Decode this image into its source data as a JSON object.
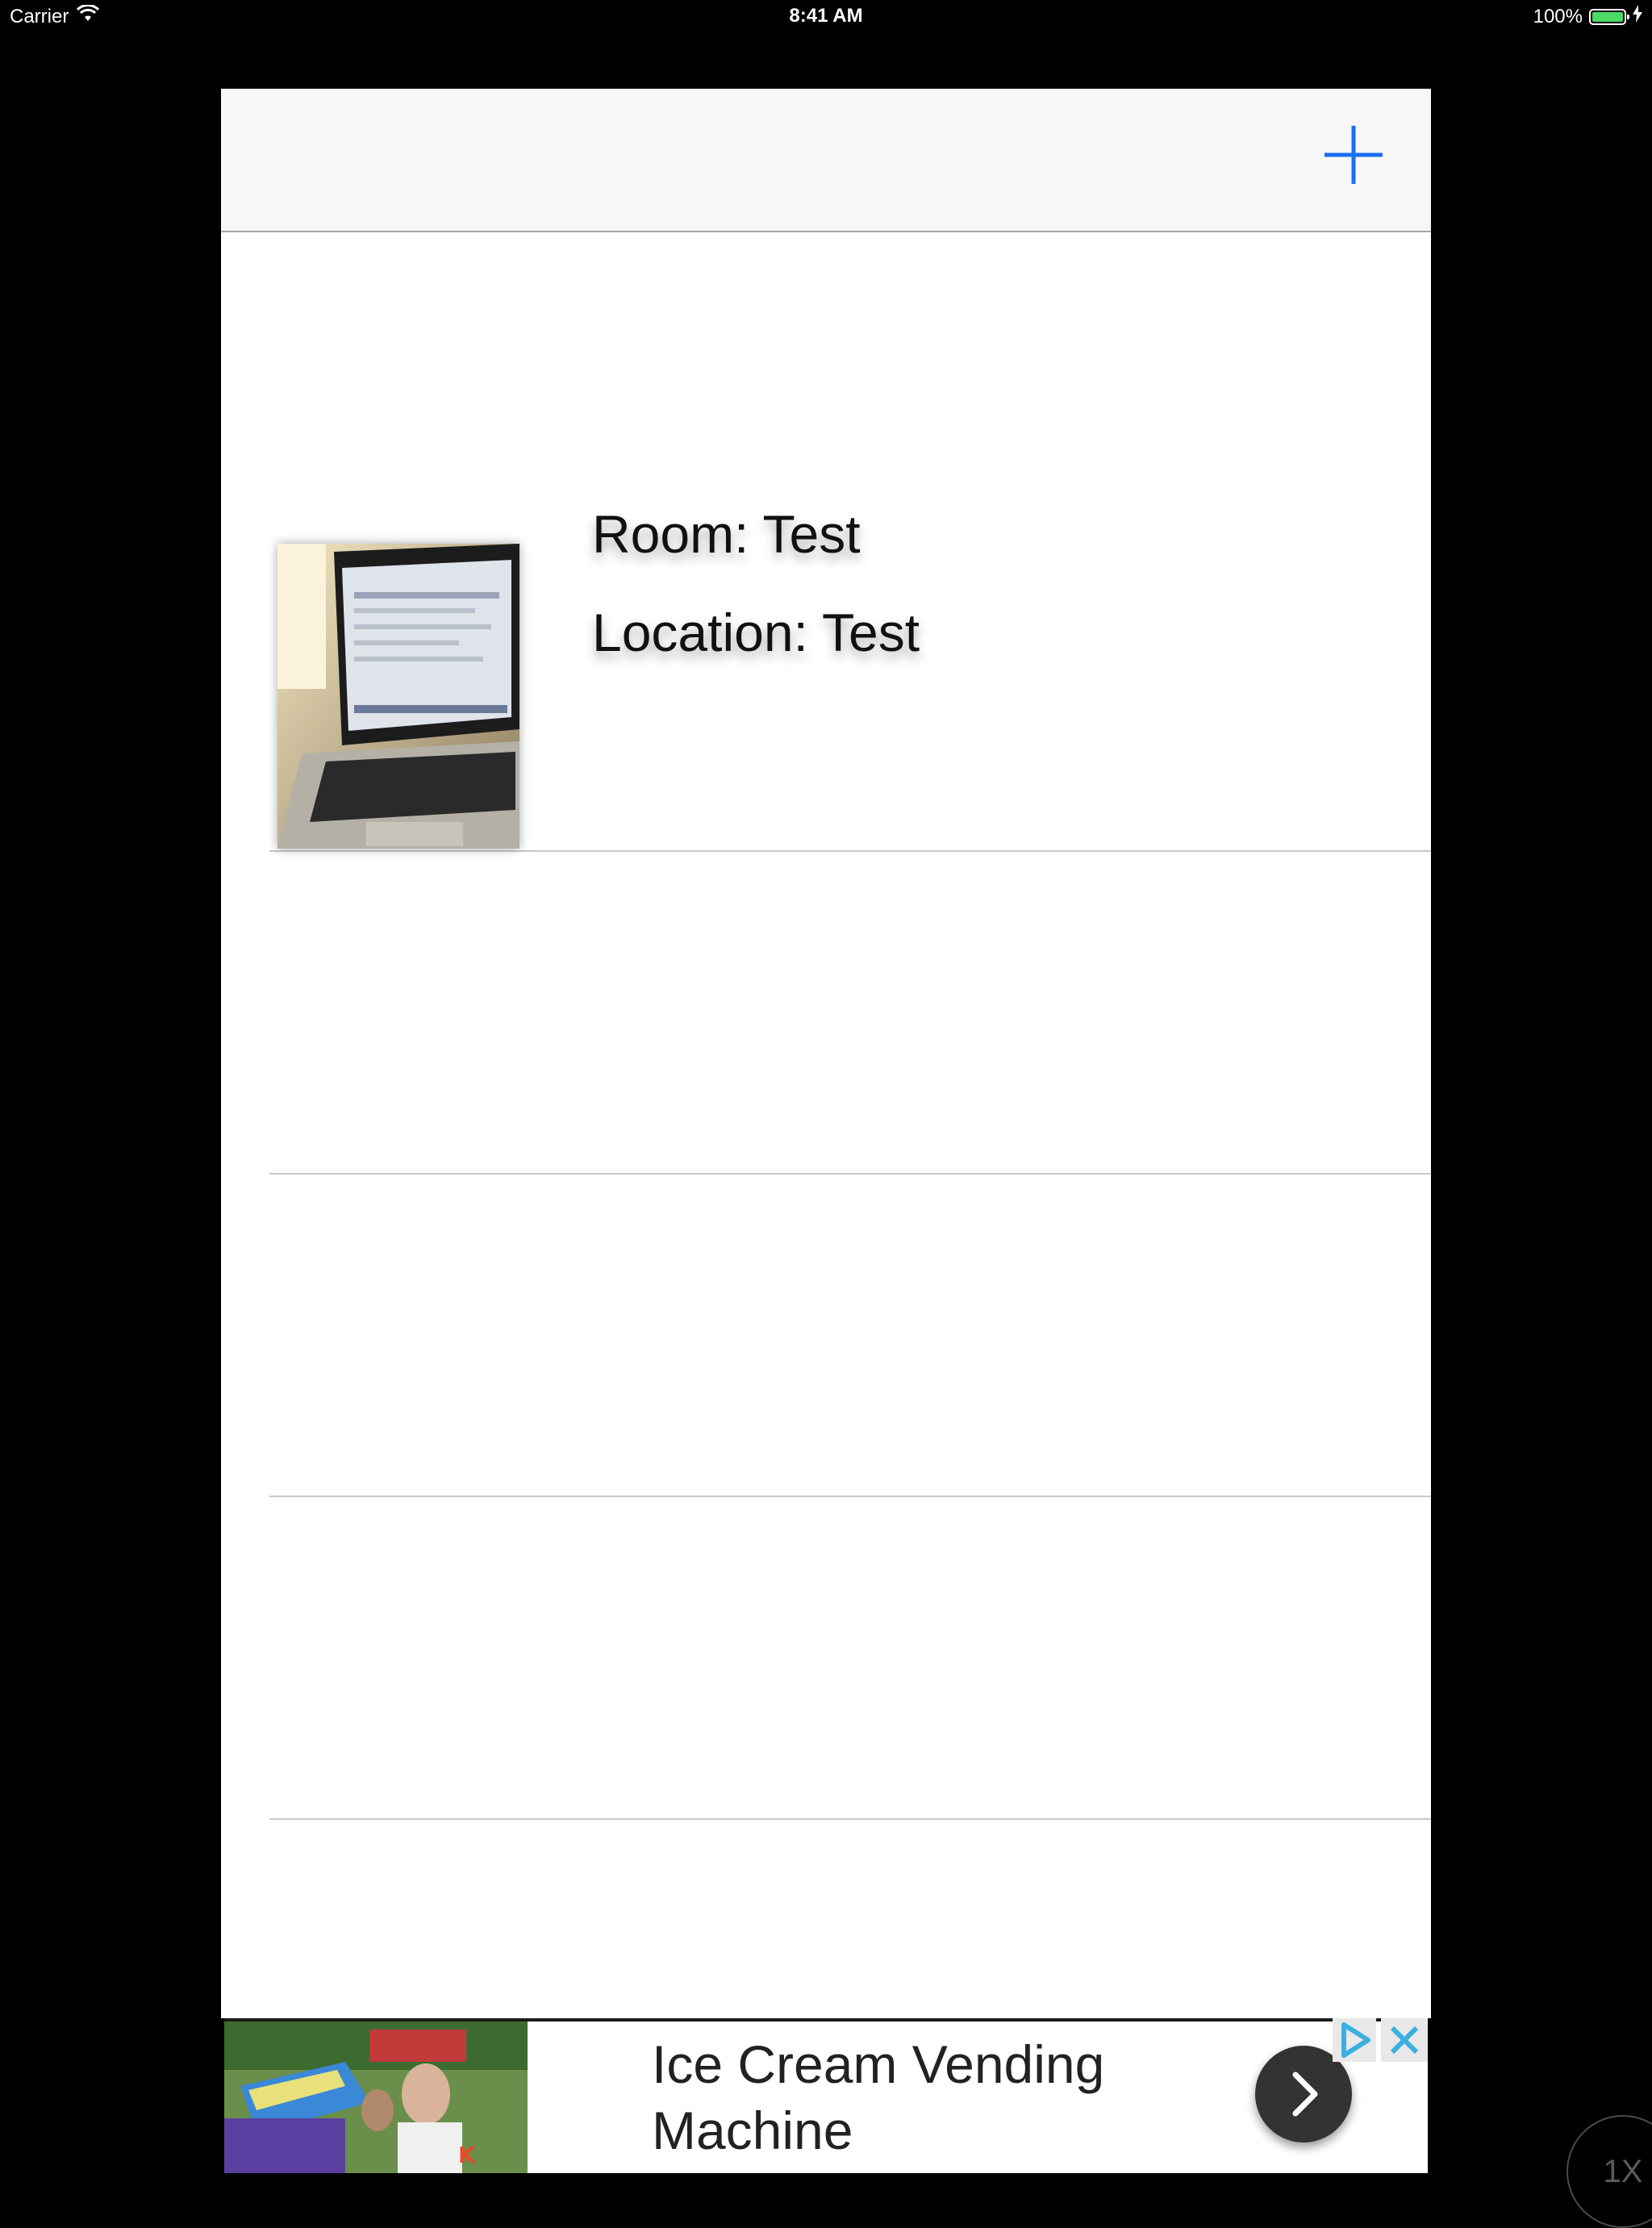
{
  "status_bar": {
    "carrier": "Carrier",
    "time": "8:41 AM",
    "battery": "100%",
    "icons": [
      "wifi-icon",
      "battery-icon",
      "charging-bolt-icon"
    ]
  },
  "nav_bar": {
    "add_icon": "plus-icon",
    "accent_color": "#1a6ff2"
  },
  "rooms": [
    {
      "room_label": "Room: Test",
      "location_label": "Location: Test",
      "thumbnail": "laptop-photo"
    }
  ],
  "ad": {
    "title": "Ice Cream Vending Machine",
    "icons": [
      "ad-choices-icon",
      "close-icon",
      "chevron-right-icon"
    ]
  },
  "zoom_badge": "1X"
}
